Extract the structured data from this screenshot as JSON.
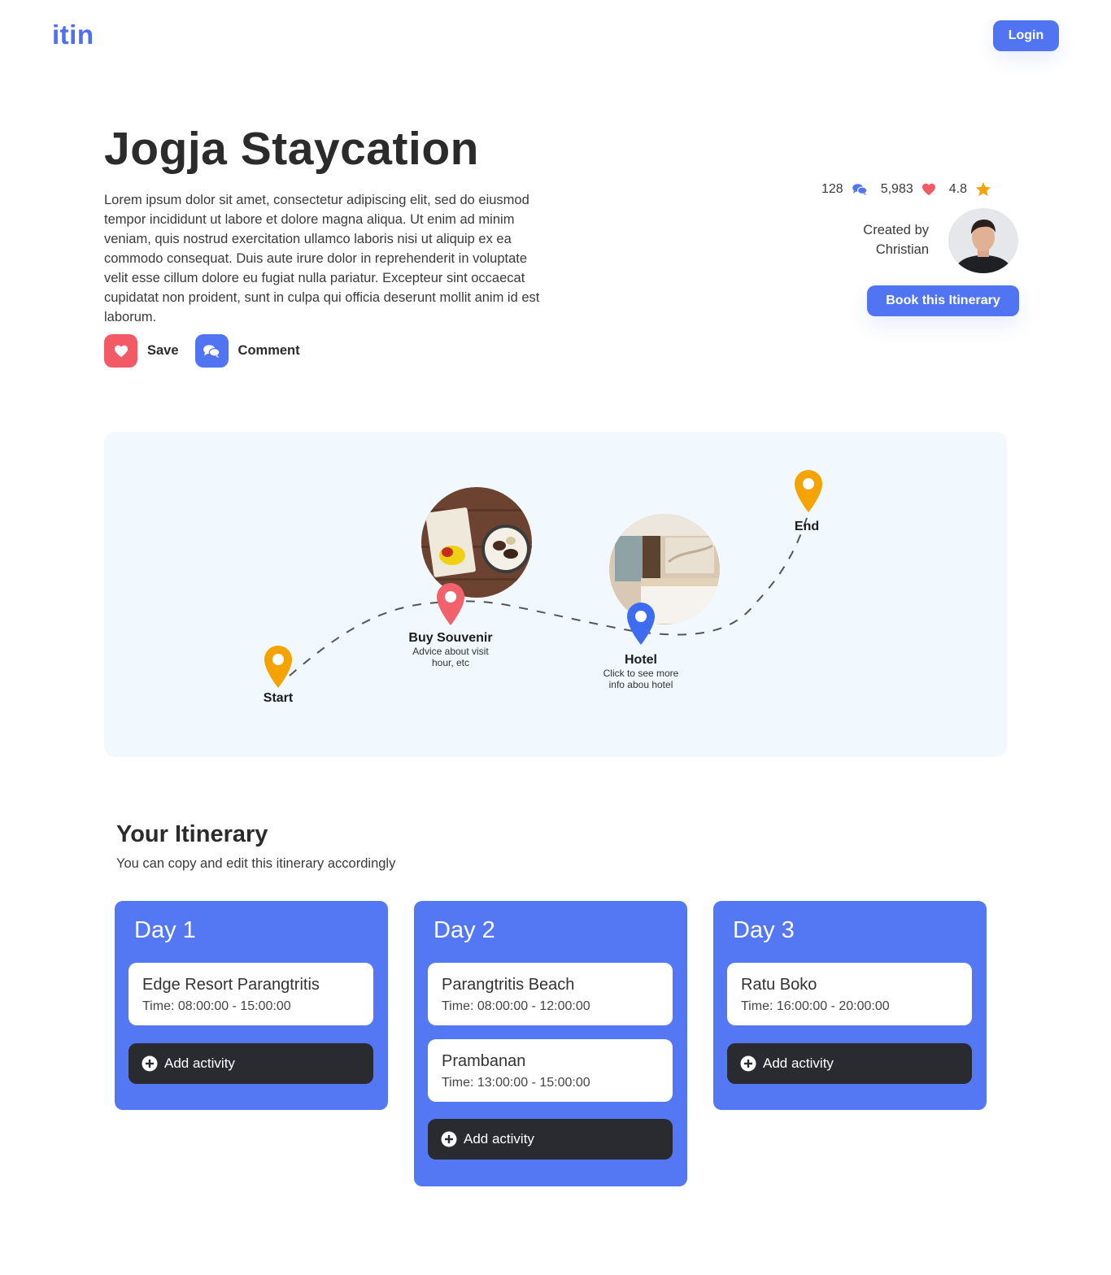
{
  "header": {
    "logo": "itin",
    "login_label": "Login"
  },
  "itinerary": {
    "title": "Jogja Staycation",
    "description": "Lorem ipsum dolor sit amet, consectetur adipiscing elit, sed do eiusmod tempor incididunt ut labore et dolore magna aliqua. Ut enim ad minim veniam, quis nostrud exercitation ullamco laboris nisi ut aliquip ex ea commodo consequat. Duis aute irure dolor in reprehenderit in voluptate velit esse cillum dolore eu fugiat nulla pariatur. Excepteur sint occaecat cupidatat non proident, sunt in culpa qui officia deserunt mollit anim id est laborum.",
    "save_label": "Save",
    "comment_label": "Comment"
  },
  "stats": {
    "comments": "128",
    "likes": "5,983",
    "rating": "4.8"
  },
  "creator": {
    "line1": "Created by",
    "name": "Christian"
  },
  "book_label": "Book this Itinerary",
  "map": {
    "start_label": "Start",
    "end_label": "End",
    "stop1": {
      "title": "Buy Souvenir",
      "line1": "Advice about visit",
      "line2": "hour, etc"
    },
    "stop2": {
      "title": "Hotel",
      "line1": "Click to see more",
      "line2": "info abou hotel"
    }
  },
  "section": {
    "title": "Your Itinerary",
    "subtitle": "You can copy and edit this itinerary accordingly"
  },
  "add_activity_label": "Add activity",
  "days": [
    {
      "title": "Day 1",
      "activities": [
        {
          "name": "Edge Resort Parangtritis",
          "time": "Time: 08:00:00 - 15:00:00"
        }
      ]
    },
    {
      "title": "Day 2",
      "activities": [
        {
          "name": "Parangtritis Beach",
          "time": "Time: 08:00:00 - 12:00:00"
        },
        {
          "name": "Prambanan",
          "time": "Time: 13:00:00 - 15:00:00"
        }
      ]
    },
    {
      "title": "Day 3",
      "activities": [
        {
          "name": "Ratu Boko",
          "time": "Time: 16:00:00 - 20:00:00"
        }
      ]
    }
  ],
  "colors": {
    "primary": "#5174f2",
    "danger": "#f25a66",
    "dark": "#2a2b30",
    "pin_yellow": "#f5a300",
    "pin_red": "#f2626d",
    "pin_blue": "#3d6cf0",
    "map_bg": "#f1f8fe",
    "star": "#f5a300"
  }
}
